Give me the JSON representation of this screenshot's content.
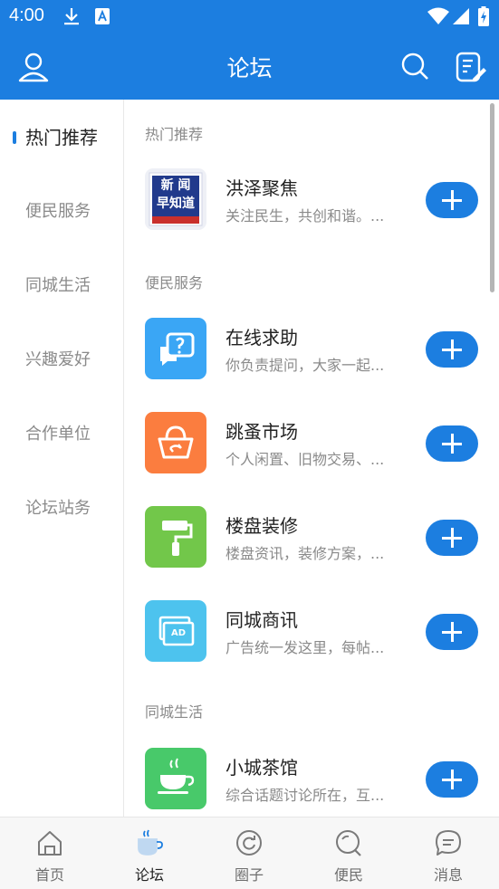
{
  "status_bar": {
    "time": "4:00"
  },
  "header": {
    "title": "论坛"
  },
  "sidebar": {
    "items": [
      {
        "label": "热门推荐"
      },
      {
        "label": "便民服务"
      },
      {
        "label": "同城生活"
      },
      {
        "label": "兴趣爱好"
      },
      {
        "label": "合作单位"
      },
      {
        "label": "论坛站务"
      }
    ]
  },
  "sections": [
    {
      "title": "热门推荐",
      "rows": [
        {
          "title": "洪泽聚焦",
          "desc": "关注民生，共创和谐。...",
          "badge_line1": "新 闻",
          "badge_line2": "早知道"
        }
      ]
    },
    {
      "title": "便民服务",
      "rows": [
        {
          "title": "在线求助",
          "desc": "你负责提问，大家一起...",
          "icon": "question-chat-icon",
          "color": "#3aa6f5"
        },
        {
          "title": "跳蚤市场",
          "desc": "个人闲置、旧物交易、...",
          "icon": "basket-icon",
          "color": "#fb7d3f"
        },
        {
          "title": "楼盘装修",
          "desc": "楼盘资讯，装修方案，...",
          "icon": "paint-roller-icon",
          "color": "#72c74a"
        },
        {
          "title": "同城商讯",
          "desc": "广告统一发这里，每帖...",
          "icon": "ad-icon",
          "color": "#4dc3ee",
          "ad_text": "AD"
        }
      ]
    },
    {
      "title": "同城生活",
      "rows": [
        {
          "title": "小城茶馆",
          "desc": "综合话题讨论所在，互...",
          "icon": "teacup-icon",
          "color": "#48c96a"
        }
      ]
    }
  ],
  "bottom_nav": {
    "items": [
      {
        "label": "首页",
        "icon": "home-icon"
      },
      {
        "label": "论坛",
        "icon": "coffee-cup-icon"
      },
      {
        "label": "圈子",
        "icon": "refresh-circle-icon"
      },
      {
        "label": "便民",
        "icon": "search-circle-icon"
      },
      {
        "label": "消息",
        "icon": "message-bubble-icon"
      }
    ],
    "active_index": 1
  },
  "colors": {
    "primary": "#1c7ee0",
    "text": "#222222",
    "muted": "#8a8a8a"
  }
}
